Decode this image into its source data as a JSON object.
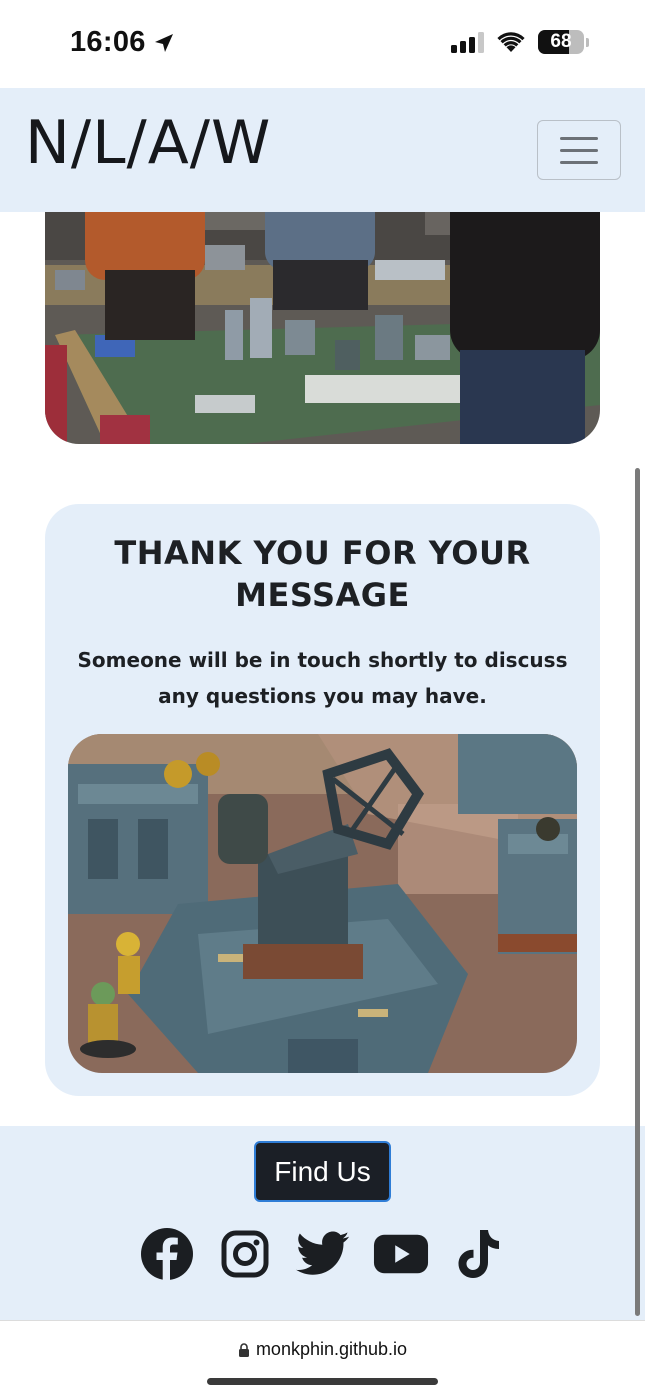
{
  "status_bar": {
    "time": "16:06",
    "battery_percent": "68",
    "battery_level": 0.68
  },
  "navbar": {
    "brand": "N/L/A/W",
    "menu_icon": "hamburger-icon"
  },
  "message": {
    "title": "THANK YOU FOR YOUR MESSAGE",
    "body": "Someone will be in touch shortly to discuss any questions you may have."
  },
  "footer": {
    "find_us_label": "Find Us",
    "social_icons": [
      "facebook-icon",
      "instagram-icon",
      "twitter-icon",
      "youtube-icon",
      "tiktok-icon"
    ]
  },
  "browser": {
    "url": "monkphin.github.io"
  },
  "colors": {
    "light_panel": "#e4eef9",
    "dark_button": "#1b1f26",
    "button_outline": "#2f7dd6",
    "text_dark": "#1d2024"
  }
}
